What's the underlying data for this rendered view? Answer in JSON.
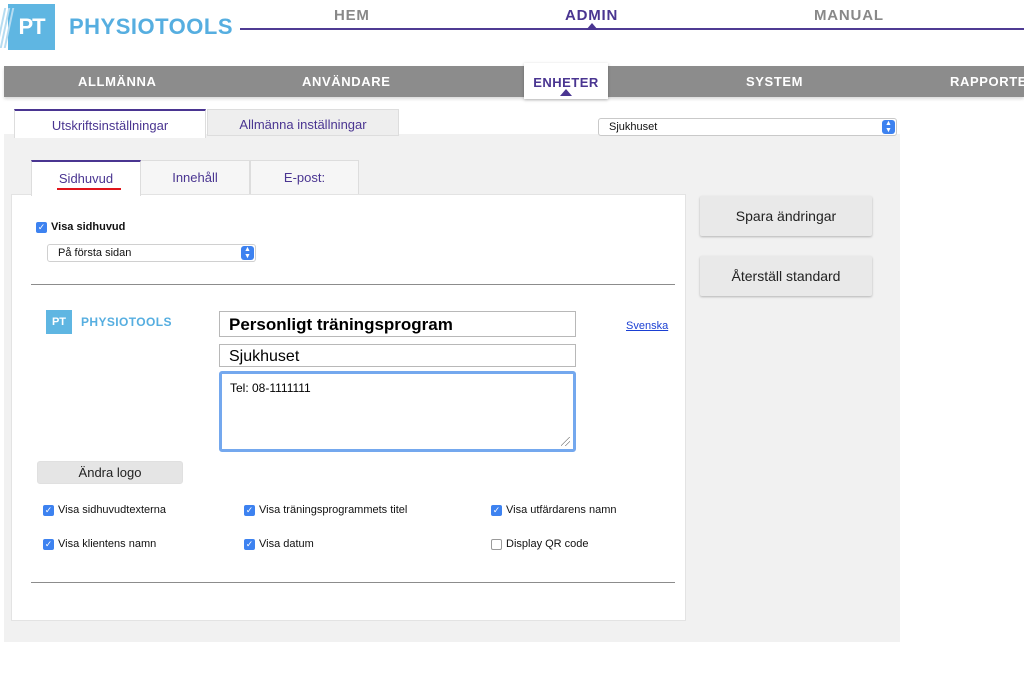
{
  "brand": {
    "logo_text": "PT",
    "name": "PHYSIOTOOLS"
  },
  "top_nav": [
    {
      "label": "HEM"
    },
    {
      "label": "ADMIN"
    },
    {
      "label": "MANUAL"
    }
  ],
  "admin_nav": [
    {
      "label": "ALLMÄNNA"
    },
    {
      "label": "ANVÄNDARE"
    },
    {
      "label": "ENHETER"
    },
    {
      "label": "SYSTEM"
    },
    {
      "label": "RAPPORTER"
    }
  ],
  "settings_tabs": [
    {
      "label": "Utskriftsinställningar"
    },
    {
      "label": "Allmänna inställningar"
    }
  ],
  "unit_select": {
    "value": "Sjukhuset"
  },
  "inner_tabs": [
    {
      "label": "Sidhuvud"
    },
    {
      "label": "Innehåll"
    },
    {
      "label": "E-post:"
    }
  ],
  "header_section": {
    "show_header": {
      "label": "Visa sidhuvud",
      "checked": true
    },
    "placement_select": {
      "value": "På första sidan"
    }
  },
  "preview": {
    "logo_text": "PT",
    "logo_name": "PHYSIOTOOLS",
    "title_value": "Personligt träningsprogram",
    "unit_value": "Sjukhuset",
    "contact_value": "Tel: 08-1111111",
    "language_link": "Svenska",
    "change_logo_button": "Ändra logo"
  },
  "options": [
    {
      "label": "Visa sidhuvudtexterna",
      "checked": true
    },
    {
      "label": "Visa träningsprogrammets titel",
      "checked": true
    },
    {
      "label": "Visa utfärdarens namn",
      "checked": true
    },
    {
      "label": "Visa klientens namn",
      "checked": true
    },
    {
      "label": "Visa datum",
      "checked": true
    },
    {
      "label": "Display QR code",
      "checked": false
    }
  ],
  "actions": {
    "save_label": "Spara ändringar",
    "reset_label": "Återställ standard"
  },
  "colors": {
    "brand_blue": "#5fb6e2",
    "accent_purple": "#4a3591",
    "nav_gray": "#8c8c8c",
    "checkbox_blue": "#3d82f0",
    "active_tab_underline": "#e0141b"
  }
}
